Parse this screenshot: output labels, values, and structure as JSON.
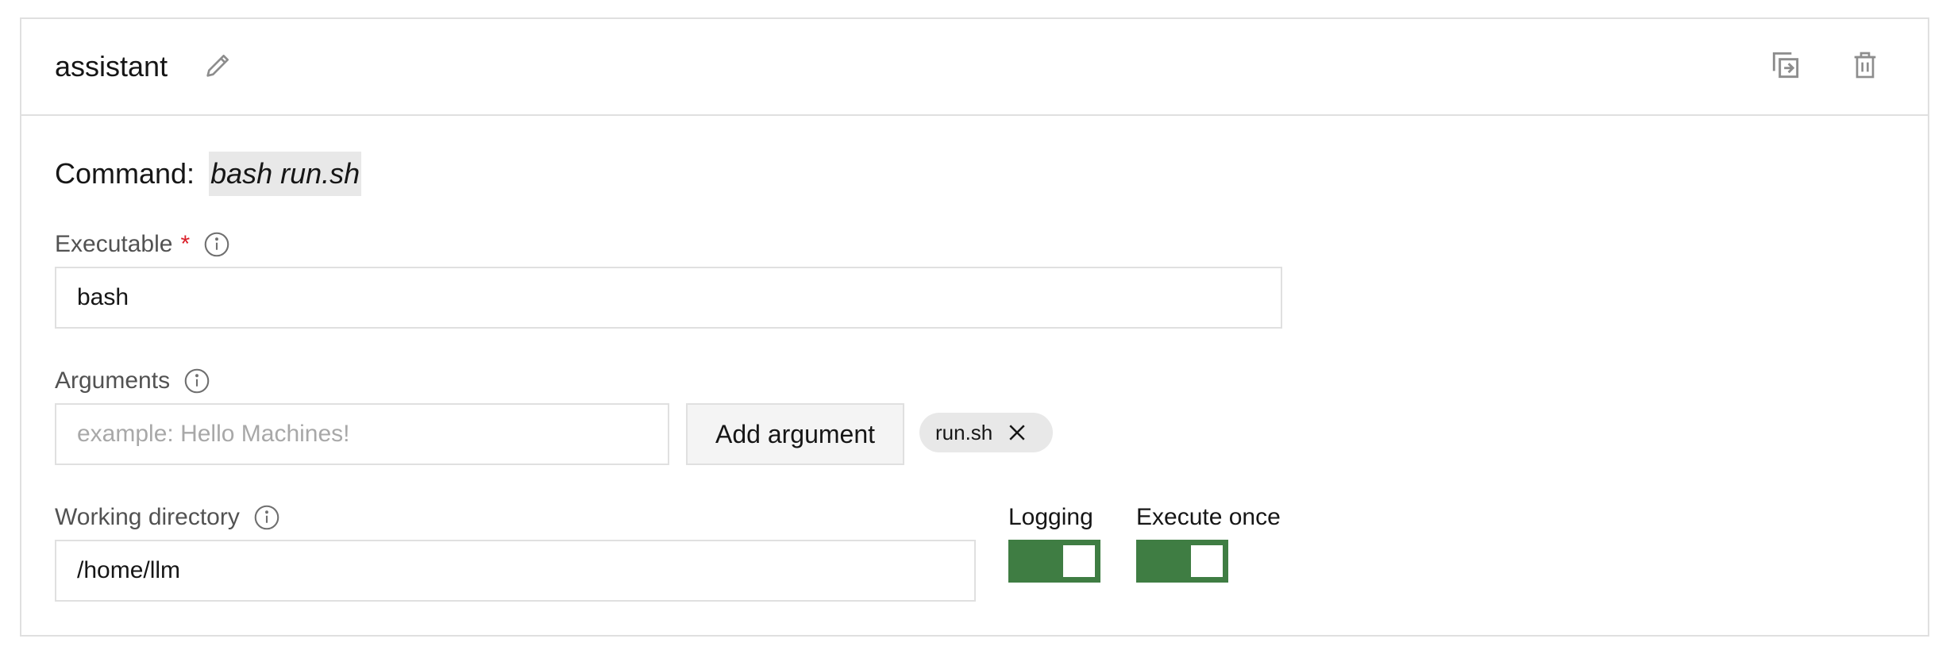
{
  "panel": {
    "title": "assistant",
    "icons": {
      "edit": "pencil-icon",
      "copy": "copy-icon",
      "delete": "trash-icon"
    }
  },
  "command": {
    "label": "Command:",
    "value": "bash run.sh"
  },
  "executable": {
    "label": "Executable",
    "required_mark": "*",
    "value": "bash"
  },
  "arguments": {
    "label": "Arguments",
    "placeholder": "example: Hello Machines!",
    "add_button": "Add argument",
    "tags": [
      "run.sh"
    ]
  },
  "working_directory": {
    "label": "Working directory",
    "value": "/home/llm"
  },
  "toggles": {
    "logging": {
      "label": "Logging",
      "on": true
    },
    "execute_once": {
      "label": "Execute once",
      "on": true
    }
  },
  "colors": {
    "accent_green": "#3f7d43",
    "required_red": "#da1e28",
    "border": "#e0e0e0"
  }
}
